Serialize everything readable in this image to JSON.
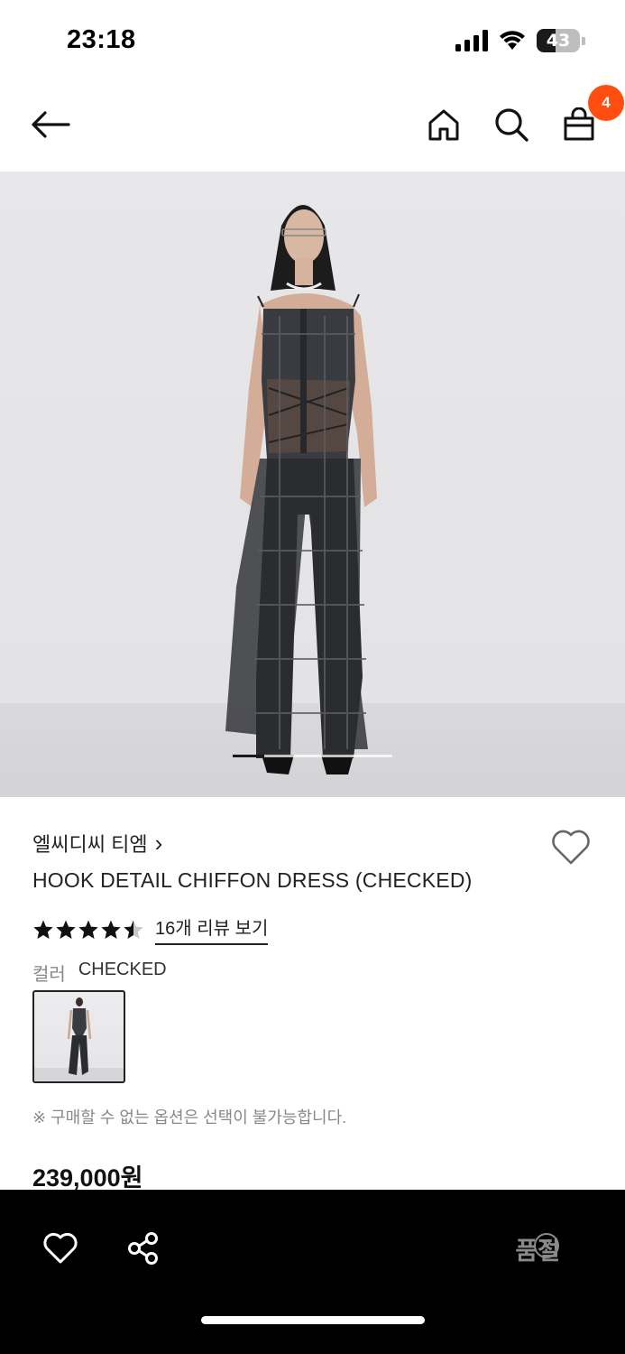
{
  "status_bar": {
    "time": "23:18",
    "battery": "43",
    "battery_level": 0.43
  },
  "nav": {
    "cart_count": "4"
  },
  "hero": {
    "carousel_position": 0.2
  },
  "product": {
    "brand": "엘씨디씨 티엠",
    "brand_chevron": "›",
    "name": "HOOK DETAIL CHIFFON DRESS (CHECKED)",
    "rating": 4.5,
    "review_link": "16개 리뷰 보기",
    "color_label": "컬러",
    "color_value": "CHECKED",
    "notice": "※ 구매할 수 없는 옵션은 선택이 불가능합니다.",
    "price": "239,000원"
  },
  "bottom_bar": {
    "status": "품절",
    "help": "?"
  },
  "colors": {
    "badge": "#ff4e0f",
    "bottom_bar": "#000000",
    "soldout_text": "#8a8a8a"
  }
}
